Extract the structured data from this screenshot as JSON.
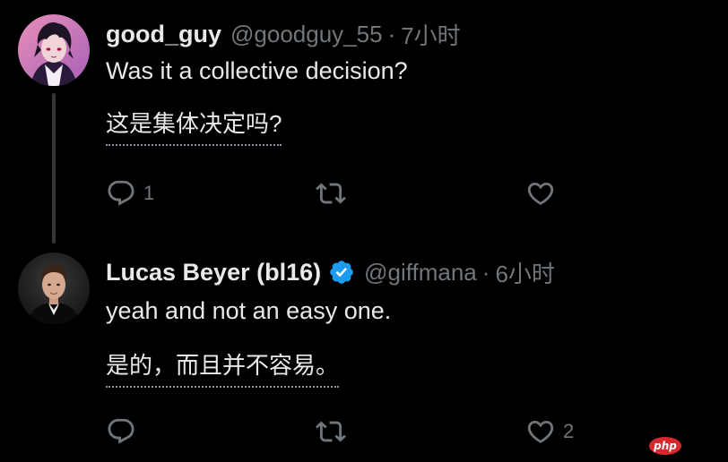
{
  "tweets": [
    {
      "display_name": "good_guy",
      "handle": "@goodguy_55",
      "separator": "·",
      "time": "7小时",
      "text": "Was it a collective decision?",
      "translation": "这是集体决定吗?",
      "reply_count": "1",
      "retweet_count": "",
      "like_count": "",
      "verified": false
    },
    {
      "display_name": "Lucas Beyer (bl16)",
      "handle": "@giffmana",
      "separator": "·",
      "time": "6小时",
      "text": "yeah and not an easy one.",
      "translation": "是的，而且并不容易。",
      "reply_count": "",
      "retweet_count": "",
      "like_count": "2",
      "verified": true
    }
  ],
  "watermark": "php",
  "colors": {
    "background": "#000000",
    "text_primary": "#e7e9ea",
    "text_secondary": "#71767b",
    "verified_blue": "#1d9bf0",
    "thread_line": "#333639"
  },
  "icons": [
    "avatar",
    "verified-badge-icon",
    "reply-icon",
    "retweet-icon",
    "like-icon"
  ]
}
